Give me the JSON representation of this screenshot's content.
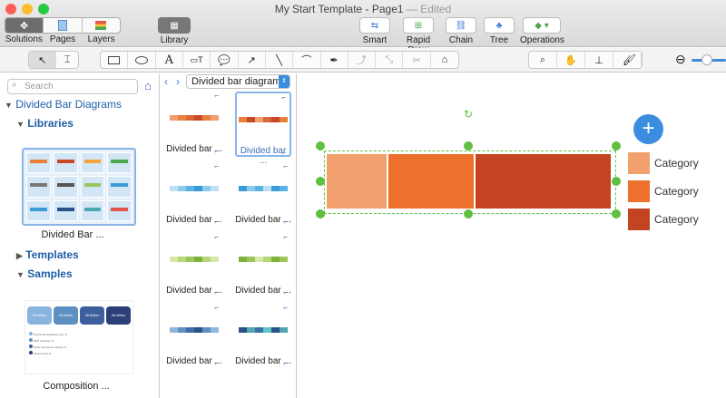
{
  "window": {
    "title": "My Start Template - Page1",
    "edited": "— Edited"
  },
  "toolbar": {
    "solutions": "Solutions",
    "pages": "Pages",
    "layers": "Layers",
    "library": "Library",
    "smart": "Smart",
    "rapid_draw": "Rapid Draw",
    "chain": "Chain",
    "tree": "Tree",
    "operations": "Operations"
  },
  "sidebar": {
    "search_placeholder": "Search",
    "root": "Divided Bar Diagrams",
    "libraries": "Libraries",
    "library_thumb_label": "Divided Bar ...",
    "templates": "Templates",
    "samples": "Samples",
    "sample_thumb_label": "Composition ...",
    "sample_preview": {
      "boxes": [
        "25 billion",
        "45 billion",
        "36 billion",
        "46 billion"
      ],
      "legend": [
        "Nonfifl access&amp;nent; $",
        "GPP citizenss; $",
        "Other not-source access; $",
        "Others tiens; $"
      ]
    }
  },
  "library_panel": {
    "dropdown": "Divided bar diagrams",
    "item_label": "Divided bar ...",
    "rows": [
      {
        "colors": [
          "#f0a070",
          "#e8803c",
          "#d9673a",
          "#c9482a",
          "#e8803c",
          "#f0a070"
        ]
      },
      {
        "colors": [
          "#bfe0f4",
          "#8ccbed",
          "#5cb2e4",
          "#3b9bd9",
          "#8ccbed",
          "#bfe0f4"
        ]
      },
      {
        "colors": [
          "#d6e7a8",
          "#b9d77a",
          "#9cc65a",
          "#7eb33b",
          "#b9d77a",
          "#d6e7a8"
        ]
      },
      {
        "colors": [
          "#8fb7d9",
          "#5d8fc0",
          "#3e6fa8",
          "#2c5189",
          "#5d8fc0",
          "#8fb7d9"
        ]
      }
    ],
    "rows_b": [
      {
        "colors": [
          "#e8803c",
          "#c9482a",
          "#f0a070",
          "#d9673a",
          "#c9482a",
          "#e8803c"
        ]
      },
      {
        "colors": [
          "#3b9bd9",
          "#8ccbed",
          "#5cb2e4",
          "#bfe0f4",
          "#3b9bd9",
          "#5cb2e4"
        ]
      },
      {
        "colors": [
          "#7eb33b",
          "#9cc65a",
          "#d6e7a8",
          "#b9d77a",
          "#7eb33b",
          "#9cc65a"
        ]
      },
      {
        "colors": [
          "#2c5189",
          "#4ba8b0",
          "#3e6fa8",
          "#5fc4c9",
          "#2c5189",
          "#4ba8b0"
        ]
      }
    ]
  },
  "canvas": {
    "bar_colors": [
      "#f2a06e",
      "#ee702d",
      "#c44421"
    ],
    "legend": [
      {
        "label": "Category",
        "color": "#f2a06e"
      },
      {
        "label": "Category",
        "color": "#ee702d"
      },
      {
        "label": "Category",
        "color": "#c44421"
      }
    ],
    "add_button": "+"
  },
  "colors": {
    "accent": "#3b8de0",
    "handle": "#5fbf3f"
  }
}
